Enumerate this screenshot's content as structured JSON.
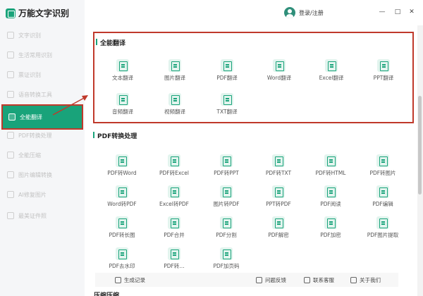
{
  "app": {
    "title": "万能文字识别"
  },
  "header": {
    "login_label": "登录/注册",
    "minimize": "—",
    "maximize": "□",
    "close": "✕"
  },
  "sidebar": {
    "items": [
      {
        "label": "文字识别"
      },
      {
        "label": "生活常用识别"
      },
      {
        "label": "票证识别"
      },
      {
        "label": "语音转换工具"
      },
      {
        "label": "全能翻译"
      },
      {
        "label": "PDF转换处理"
      },
      {
        "label": "全能压缩"
      },
      {
        "label": "图片编辑转换"
      },
      {
        "label": "AI修复图片"
      },
      {
        "label": "最美证件照"
      }
    ]
  },
  "sections": {
    "translate": {
      "title": "全能翻译",
      "tiles": [
        {
          "label": "文本翻译"
        },
        {
          "label": "图片翻译"
        },
        {
          "label": "PDF翻译"
        },
        {
          "label": "Word翻译"
        },
        {
          "label": "Excel翻译"
        },
        {
          "label": "PPT翻译"
        },
        {
          "label": "音频翻译"
        },
        {
          "label": "视频翻译"
        },
        {
          "label": "TXT翻译"
        }
      ]
    },
    "pdf": {
      "title": "PDF转换处理",
      "tiles": [
        {
          "label": "PDF转Word"
        },
        {
          "label": "PDF转Excel"
        },
        {
          "label": "PDF转PPT"
        },
        {
          "label": "PDF转TXT"
        },
        {
          "label": "PDF转HTML"
        },
        {
          "label": "PDF转图片"
        },
        {
          "label": "Word转PDF"
        },
        {
          "label": "Excel转PDF"
        },
        {
          "label": "图片转PDF"
        },
        {
          "label": "PPT转PDF"
        },
        {
          "label": "PDF阅读"
        },
        {
          "label": "PDF编辑"
        },
        {
          "label": "PDF转长图"
        },
        {
          "label": "PDF合并"
        },
        {
          "label": "PDF分割"
        },
        {
          "label": "PDF解密"
        },
        {
          "label": "PDF加密"
        },
        {
          "label": "PDF图片提取"
        },
        {
          "label": "PDF去水印"
        },
        {
          "label": "PDF转…"
        },
        {
          "label": "PDF加页码"
        }
      ]
    },
    "next_title": "压缩压缩"
  },
  "footer": {
    "history": "生成记录",
    "feedback": "问题反馈",
    "contact": "联系客服",
    "about": "关于我们"
  },
  "colors": {
    "accent": "#19a37a",
    "annotation": "#c0392b"
  }
}
